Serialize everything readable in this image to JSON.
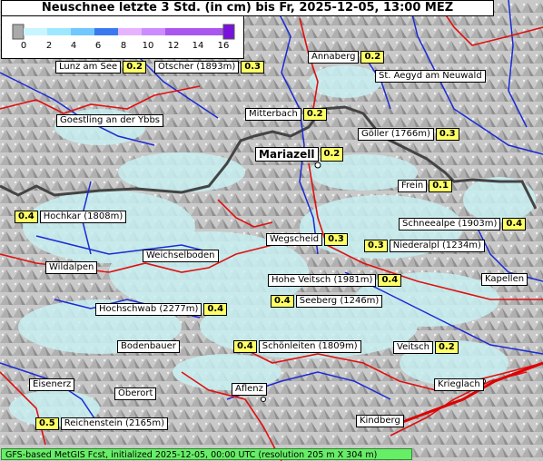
{
  "title": "Neuschnee letzte 3 Std. (in cm) bis Fr, 2025-12-05, 13:00 MEZ",
  "legend": {
    "ticks": [
      "0",
      "2",
      "4",
      "6",
      "8",
      "10",
      "12",
      "14",
      "16"
    ],
    "colors": [
      "#aaaaaa",
      "#c8f5ff",
      "#9ee8ff",
      "#70c8ff",
      "#3a78f0",
      "#e6b4ff",
      "#cc8cff",
      "#aa55ee",
      "#7a10dd"
    ]
  },
  "places": [
    {
      "id": "lunz",
      "name": "Lunz am See",
      "value": "0.2"
    },
    {
      "id": "oetscher",
      "name": "Ötscher (1893m)",
      "value": "0.3"
    },
    {
      "id": "annaberg",
      "name": "Annaberg",
      "value": "0.2"
    },
    {
      "id": "aegyd",
      "name": "St. Aegyd am Neuwald",
      "value": ""
    },
    {
      "id": "goestling",
      "name": "Goestling an der Ybbs",
      "value": ""
    },
    {
      "id": "mitterbach",
      "name": "Mitterbach",
      "value": "0.2"
    },
    {
      "id": "goeller",
      "name": "Göller (1766m)",
      "value": "0.3"
    },
    {
      "id": "mariazell",
      "name": "Mariazell",
      "value": "0.2"
    },
    {
      "id": "frein",
      "name": "Frein",
      "value": "0.1"
    },
    {
      "id": "hochkar",
      "name": "Hochkar (1808m)",
      "value": "0.4"
    },
    {
      "id": "schneealpe",
      "name": "Schneealpe (1903m)",
      "value": "0.4"
    },
    {
      "id": "wegscheid",
      "name": "Wegscheid",
      "value": "0.3"
    },
    {
      "id": "niederalpl",
      "name": "Niederalpl (1234m)",
      "value": "0.3"
    },
    {
      "id": "weichselboden",
      "name": "Weichselboden",
      "value": ""
    },
    {
      "id": "wildalpen",
      "name": "Wildalpen",
      "value": ""
    },
    {
      "id": "hoheveitsch",
      "name": "Hohe Veitsch (1981m)",
      "value": "0.4"
    },
    {
      "id": "kapellen",
      "name": "Kapellen",
      "value": ""
    },
    {
      "id": "seeberg",
      "name": "Seeberg (1246m)",
      "value": "0.4"
    },
    {
      "id": "hochschwab",
      "name": "Hochschwab (2277m)",
      "value": "0.4"
    },
    {
      "id": "bodenbauer",
      "name": "Bodenbauer",
      "value": ""
    },
    {
      "id": "schoenleiten",
      "name": "Schönleiten (1809m)",
      "value": "0.4"
    },
    {
      "id": "veitsch",
      "name": "Veitsch",
      "value": "0.2"
    },
    {
      "id": "eisenerz",
      "name": "Eisenerz",
      "value": ""
    },
    {
      "id": "oberort",
      "name": "Oberort",
      "value": ""
    },
    {
      "id": "aflenz",
      "name": "Aflenz",
      "value": ""
    },
    {
      "id": "krieglach",
      "name": "Krieglach",
      "value": ""
    },
    {
      "id": "kindberg",
      "name": "Kindberg",
      "value": ""
    },
    {
      "id": "reichenstein",
      "name": "Reichenstein (2165m)",
      "value": "0.5"
    }
  ],
  "footer": "GFS-based MetGIS Fcst, initialized 2025-12-05, 00:00 UTC  (resolution 205 m X 304 m)"
}
